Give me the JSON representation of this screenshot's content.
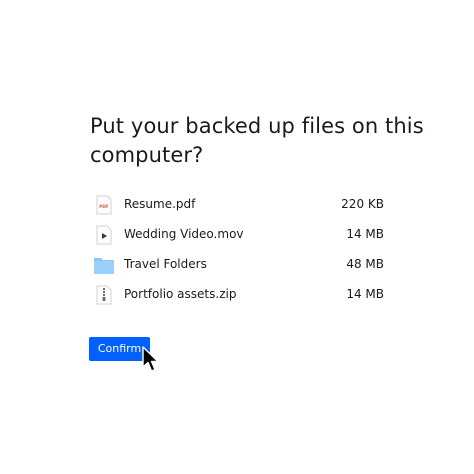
{
  "dialog": {
    "title": "Put your backed up files on this computer?"
  },
  "files": [
    {
      "name": "Resume.pdf",
      "size": "220 KB",
      "icon": "pdf-file-icon",
      "badge": "PDF"
    },
    {
      "name": "Wedding Video.mov",
      "size": "14 MB",
      "icon": "video-file-icon"
    },
    {
      "name": "Travel Folders",
      "size": "48 MB",
      "icon": "folder-icon"
    },
    {
      "name": "Portfolio assets.zip",
      "size": "14 MB",
      "icon": "zip-file-icon"
    }
  ],
  "actions": {
    "confirm_label": "Confirm"
  },
  "colors": {
    "accent": "#0061fe",
    "folder": "#8ec6f7",
    "text": "#1e1919",
    "pdf_badge": "#e8553d"
  }
}
